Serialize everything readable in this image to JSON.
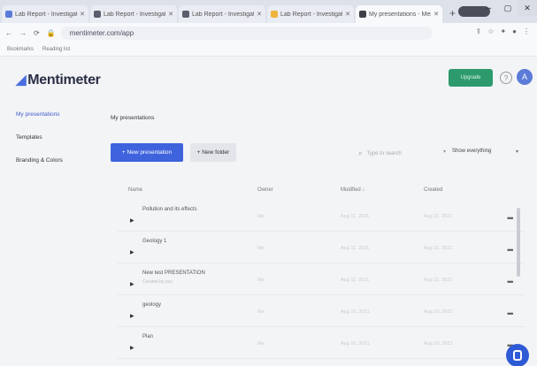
{
  "browser": {
    "tabs": [
      {
        "title": "Lab Report - Investigation",
        "color": "#5b7bd8",
        "active": false
      },
      {
        "title": "Lab Report - Investigation",
        "color": "#5a5f6e",
        "active": false
      },
      {
        "title": "Lab Report - Investigation",
        "color": "#5a5f6e",
        "active": false
      },
      {
        "title": "Lab Report - Investigation",
        "color": "#f0b43c",
        "active": false
      },
      {
        "title": "My presentations - Mentimeter",
        "color": "#3d3f49",
        "active": true
      }
    ],
    "new_tab": "+",
    "url": "mentimeter.com/app",
    "bookmarks": [
      "Bookmarks",
      "Reading list"
    ]
  },
  "header": {
    "logo": "Mentimeter",
    "upgrade": "Upgrade",
    "help": "?",
    "avatar": "A"
  },
  "sidebar": {
    "items": [
      {
        "label": "My presentations",
        "active": true
      },
      {
        "label": "Templates",
        "active": false
      },
      {
        "label": "Branding & Colors",
        "active": false
      }
    ]
  },
  "main": {
    "title": "My presentations",
    "new_presentation": "+ New presentation",
    "new_folder": "+ New folder",
    "search_placeholder": "Type to search",
    "show_filter": "Show everything",
    "columns": {
      "name": "Name",
      "owner": "Owner",
      "modified": "Modified ↓",
      "created": "Created"
    },
    "rows": [
      {
        "name": "Pollution and its effects",
        "sub": "",
        "owner": "Me",
        "modified": "Aug 11, 2021",
        "created": "Aug 11, 2021"
      },
      {
        "name": "Geology 1",
        "sub": "",
        "owner": "Me",
        "modified": "Aug 11, 2021",
        "created": "Aug 11, 2021"
      },
      {
        "name": "New test PRESENTATION",
        "sub": "Created by you",
        "owner": "Me",
        "modified": "Aug 11, 2021",
        "created": "Aug 11, 2021"
      },
      {
        "name": "geology",
        "sub": "",
        "owner": "Me",
        "modified": "Aug 10, 2021",
        "created": "Aug 10, 2021"
      },
      {
        "name": "Plan",
        "sub": "",
        "owner": "Me",
        "modified": "Aug 10, 2021",
        "created": "Aug 10, 2021"
      }
    ]
  }
}
